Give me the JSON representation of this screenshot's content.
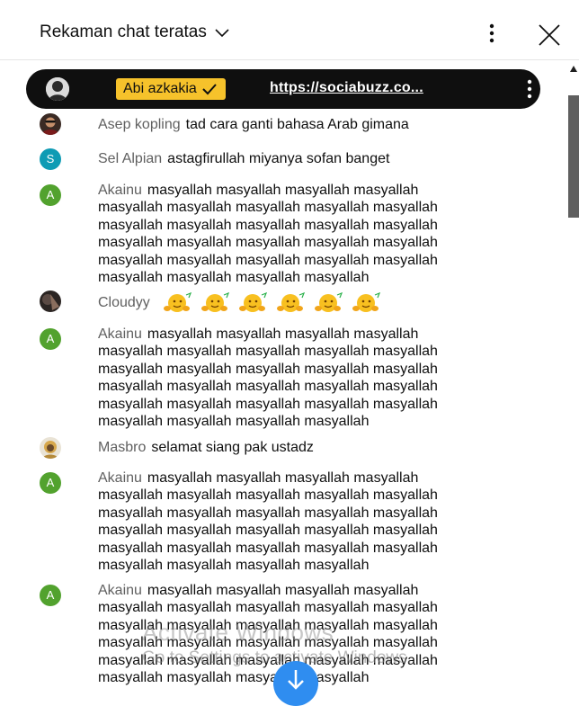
{
  "header": {
    "title": "Rekaman chat teratas",
    "icons": {
      "dropdown": "chevron-down-icon",
      "menu": "more-vert-icon",
      "close": "close-icon"
    }
  },
  "pinned": {
    "author": "Abi azkakia",
    "verified_icon": "checkmark-icon",
    "link": "https://sociabuzz.co...",
    "badge_color": "#f6c22b"
  },
  "messages": [
    {
      "author": "Asep kopling",
      "text": "tad cara ganti bahasa Arab gimana",
      "avatar_type": "photo"
    },
    {
      "author": "Sel Alpian",
      "text": "astagfirullah miyanya sofan banget",
      "avatar_letter": "S",
      "avatar_color": "#0e9bb4"
    },
    {
      "author": "Akainu",
      "text": "masyallah masyallah masyallah masyallah masyallah masyallah masyallah masyallah masyallah masyallah masyallah masyallah masyallah masyallah masyallah masyallah masyallah masyallah masyallah masyallah masyallah masyallah masyallah masyallah masyallah masyallah masyallah masyallah",
      "avatar_letter": "A",
      "avatar_color": "#52a22e"
    },
    {
      "author": "Cloudyy",
      "emoji_count": 6,
      "avatar_type": "photo"
    },
    {
      "author": "Akainu",
      "text": "masyallah masyallah masyallah masyallah masyallah masyallah masyallah masyallah masyallah masyallah masyallah masyallah masyallah masyallah masyallah masyallah masyallah masyallah masyallah masyallah masyallah masyallah masyallah masyallah masyallah masyallah masyallah masyallah",
      "avatar_letter": "A",
      "avatar_color": "#52a22e"
    },
    {
      "author": "Masbro",
      "text": "selamat siang pak ustadz",
      "avatar_type": "photo"
    },
    {
      "author": "Akainu",
      "text": "masyallah masyallah masyallah masyallah masyallah masyallah masyallah masyallah masyallah masyallah masyallah masyallah masyallah masyallah masyallah masyallah masyallah masyallah masyallah masyallah masyallah masyallah masyallah masyallah masyallah masyallah masyallah masyallah",
      "avatar_letter": "A",
      "avatar_color": "#52a22e"
    },
    {
      "author": "Akainu",
      "text": "masyallah masyallah masyallah masyallah masyallah masyallah masyallah masyallah masyallah masyallah masyallah masyallah masyallah masyallah masyallah masyallah masyallah masyallah masyallah masyallah masyallah masyallah masyallah masyallah masyallah masyallah masyallah masyallah",
      "avatar_letter": "A",
      "avatar_color": "#52a22e"
    }
  ],
  "watermark": {
    "line1": "Activate Windows",
    "line2": "Go to Settings to activate Windows."
  },
  "scroll_down_icon": "arrow-down-icon"
}
